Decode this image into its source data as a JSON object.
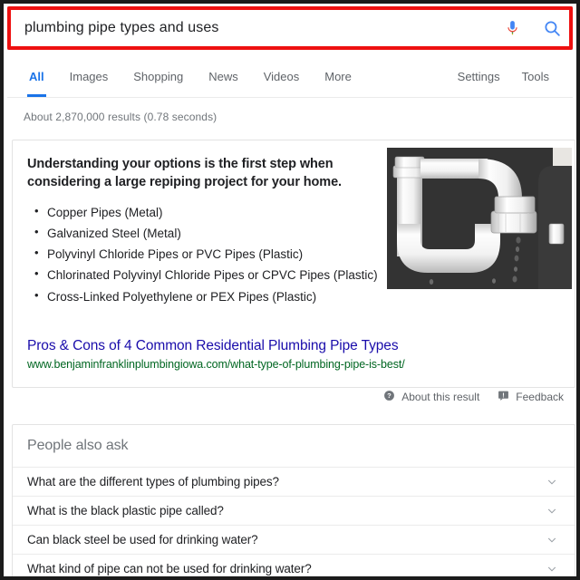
{
  "search": {
    "query": "plumbing pipe types and uses",
    "placeholder": "Search",
    "mic_icon": "microphone-icon",
    "search_icon": "search-icon"
  },
  "nav": {
    "tabs": [
      {
        "label": "All",
        "active": true
      },
      {
        "label": "Images",
        "active": false
      },
      {
        "label": "Shopping",
        "active": false
      },
      {
        "label": "News",
        "active": false
      },
      {
        "label": "Videos",
        "active": false
      },
      {
        "label": "More",
        "active": false
      }
    ],
    "meta": [
      {
        "label": "Settings"
      },
      {
        "label": "Tools"
      }
    ]
  },
  "result_stats": "About 2,870,000 results (0.78 seconds)",
  "featured_snippet": {
    "heading": "Understanding your options is the first step when considering a large repiping project for your home.",
    "bullets": [
      "Copper Pipes (Metal)",
      "Galvanized Steel (Metal)",
      "Polyvinyl Chloride Pipes or PVC Pipes (Plastic)",
      "Chlorinated Polyvinyl Chloride Pipes or CPVC Pipes (Plastic)",
      "Cross-Linked Polyethylene or PEX Pipes (Plastic)"
    ],
    "link_title": "Pros & Cons of 4 Common Residential Plumbing Pipe Types",
    "link_url": "www.benjaminfranklinplumbingiowa.com/what-type-of-plumbing-pipe-is-best/",
    "image_alt": "white-p-trap-pipe-photo"
  },
  "meta_row": {
    "about_label": "About this result",
    "about_icon": "help-circle-icon",
    "feedback_label": "Feedback",
    "feedback_icon": "feedback-flag-icon"
  },
  "people_also_ask": {
    "title": "People also ask",
    "questions": [
      "What are the different types of plumbing pipes?",
      "What is the black plastic pipe called?",
      "Can black steel be used for drinking water?",
      "What kind of pipe can not be used for drinking water?"
    ],
    "chevron_icon": "chevron-down-icon"
  },
  "colors": {
    "accent_blue": "#1a73e8",
    "link_blue": "#1a0dab",
    "url_green": "#006621",
    "text_gray": "#70757a",
    "text_dark": "#202124",
    "highlight_red": "#ee1111",
    "page_border": "#1b1b1b"
  }
}
